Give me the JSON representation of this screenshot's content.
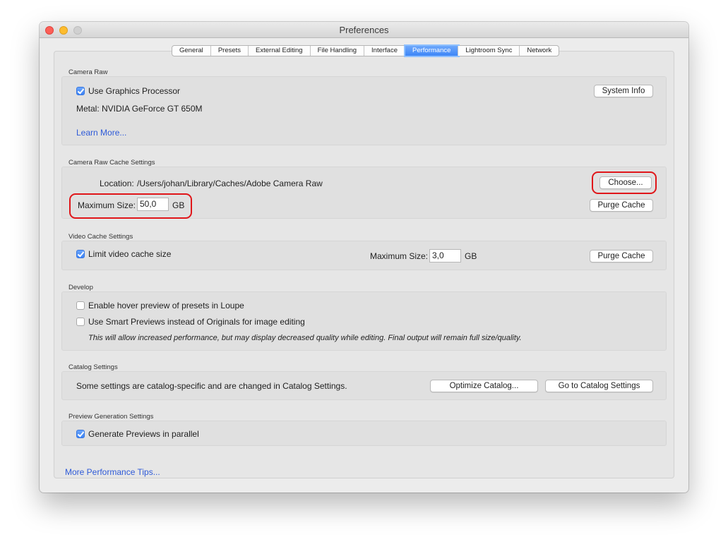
{
  "window": {
    "title": "Preferences"
  },
  "tabs": [
    {
      "label": "General"
    },
    {
      "label": "Presets"
    },
    {
      "label": "External Editing"
    },
    {
      "label": "File Handling"
    },
    {
      "label": "Interface"
    },
    {
      "label": "Performance",
      "active": true
    },
    {
      "label": "Lightroom Sync"
    },
    {
      "label": "Network"
    }
  ],
  "camera_raw": {
    "section_label": "Camera Raw",
    "use_gpu_label": "Use Graphics Processor",
    "use_gpu_checked": true,
    "system_info_button": "System Info",
    "metal_text": "Metal: NVIDIA GeForce GT 650M",
    "learn_more_link": "Learn More..."
  },
  "cache": {
    "section_label": "Camera Raw Cache Settings",
    "location_label": "Location:",
    "location_value": "/Users/johan/Library/Caches/Adobe Camera Raw",
    "choose_button": "Choose...",
    "max_size_label": "Maximum Size:",
    "max_size_value": "50,0",
    "unit": "GB",
    "purge_button": "Purge Cache"
  },
  "video_cache": {
    "section_label": "Video Cache Settings",
    "limit_label": "Limit video cache size",
    "limit_checked": true,
    "max_size_label": "Maximum Size:",
    "max_size_value": "3,0",
    "unit": "GB",
    "purge_button": "Purge Cache"
  },
  "develop": {
    "section_label": "Develop",
    "hover_preview_label": "Enable hover preview of presets in Loupe",
    "hover_preview_checked": false,
    "smart_previews_label": "Use Smart Previews instead of Originals for image editing",
    "smart_previews_checked": false,
    "note": "This will allow increased performance, but may display decreased quality while editing. Final output will remain full size/quality."
  },
  "catalog": {
    "section_label": "Catalog Settings",
    "description": "Some settings are catalog-specific and are changed in Catalog Settings.",
    "optimize_button": "Optimize Catalog...",
    "goto_button": "Go to Catalog Settings"
  },
  "preview_generation": {
    "section_label": "Preview Generation Settings",
    "parallel_label": "Generate Previews in parallel",
    "parallel_checked": true
  },
  "footer": {
    "tips_link": "More Performance Tips..."
  },
  "colors": {
    "accent": "#3d86f7",
    "link": "#2f5bd8",
    "highlight": "#e0161a"
  }
}
